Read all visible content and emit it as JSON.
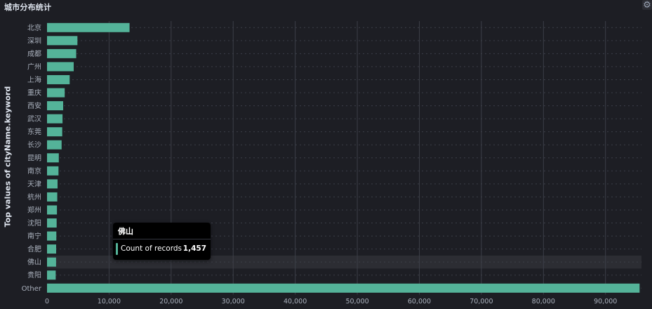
{
  "panel": {
    "title": "城市分布统计",
    "settings_icon": "gear-icon"
  },
  "colors": {
    "bar": "#54b399",
    "background": "#1d1e24",
    "grid": "#3c3f48",
    "highlight_row": "#2c2d33",
    "tick_text": "#aab1bd"
  },
  "chart_data": {
    "type": "bar",
    "orientation": "horizontal",
    "title": "城市分布统计",
    "xlabel": "",
    "ylabel": "Top values of cityName.keyword",
    "categories": [
      "北京",
      "深圳",
      "成都",
      "广州",
      "上海",
      "重庆",
      "西安",
      "武汉",
      "东莞",
      "长沙",
      "昆明",
      "南京",
      "天津",
      "杭州",
      "郑州",
      "沈阳",
      "南宁",
      "合肥",
      "佛山",
      "贵阳",
      "Other"
    ],
    "series": [
      {
        "name": "Count of records",
        "values": [
          13300,
          4900,
          4700,
          4300,
          3650,
          2850,
          2600,
          2500,
          2450,
          2350,
          1900,
          1850,
          1700,
          1650,
          1600,
          1550,
          1500,
          1470,
          1457,
          1400,
          95500
        ]
      }
    ],
    "xlim": [
      0,
      95800
    ],
    "xticks": [
      0,
      10000,
      20000,
      30000,
      40000,
      50000,
      60000,
      70000,
      80000,
      90000
    ],
    "xtick_labels": [
      "0",
      "10,000",
      "20,000",
      "30,000",
      "40,000",
      "50,000",
      "60,000",
      "70,000",
      "80,000",
      "90,000"
    ],
    "grid": true,
    "highlighted_category": "佛山"
  },
  "tooltip": {
    "title": "佛山",
    "label": "Count of records",
    "value": "1,457"
  }
}
